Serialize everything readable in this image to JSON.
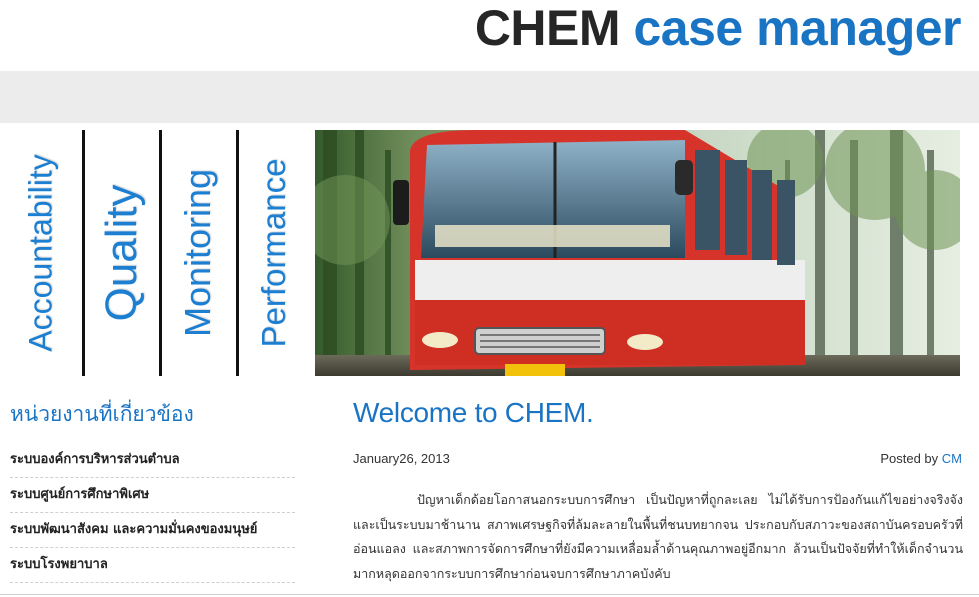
{
  "header": {
    "logo_part1": "CHEM",
    "logo_part2": "case manager",
    "logo_color_dark": "#262626",
    "logo_color_accent": "#1a74c4"
  },
  "pillars": [
    "Accountability",
    "Quality",
    "Monitoring",
    "Performance"
  ],
  "banner": {
    "icon": "school-bus-photo"
  },
  "sidebar": {
    "title": "หน่วยงานที่เกี่ยวข้อง",
    "links": [
      "ระบบองค์การบริหารส่วนตำบล",
      "ระบบศูนย์การศึกษาพิเศษ",
      "ระบบพัฒนาสังคม และความมั่นคงของมนุษย์",
      "ระบบโรงพยาบาล"
    ]
  },
  "post": {
    "title": "Welcome  to  CHEM.",
    "date": "January26, 2013",
    "posted_by_label": "Posted by",
    "author": "CM",
    "body": "ปัญหาเด็กด้อยโอกาสนอกระบบการศึกษา เป็นปัญหาที่ถูกละเลย ไม่ได้รับการป้องกันแก้ไขอย่างจริงจัง และเป็นระบบมาช้านาน สภาพเศรษฐกิจที่ล้มละลายในพื้นที่ชนบทยากจน ประกอบกับสภาวะของสถาบันครอบครัวที่อ่อนแอลง และสภาพการจัดการศึกษาที่ยังมีความเหลื่อมล้ำด้านคุณภาพอยู่อีกมาก ล้วนเป็นปัจจัยที่ทำให้เด็กจำนวนมากหลุดออกจากระบบการศึกษาก่อนจบการศึกษาภาคบังคับ"
  }
}
